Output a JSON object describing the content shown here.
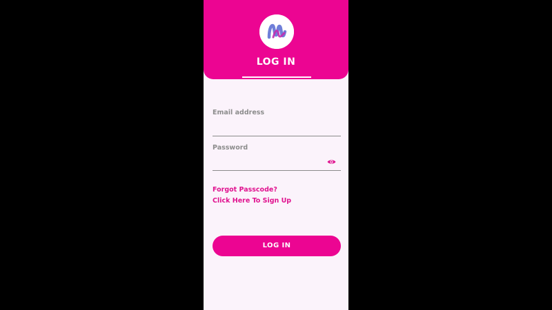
{
  "header": {
    "title": "LOG IN"
  },
  "form": {
    "email": {
      "label": "Email address",
      "value": ""
    },
    "password": {
      "label": "Password",
      "value": ""
    },
    "forgot_link": "Forgot Passcode?",
    "signup_link": "Click Here To Sign Up",
    "submit_label": "LOG IN"
  },
  "colors": {
    "brand_pink": "#ec0592",
    "background": "#fbf3fb",
    "label_gray": "#8c8c8c"
  },
  "icons": {
    "logo": "app-logo",
    "password_toggle": "eye-icon"
  }
}
